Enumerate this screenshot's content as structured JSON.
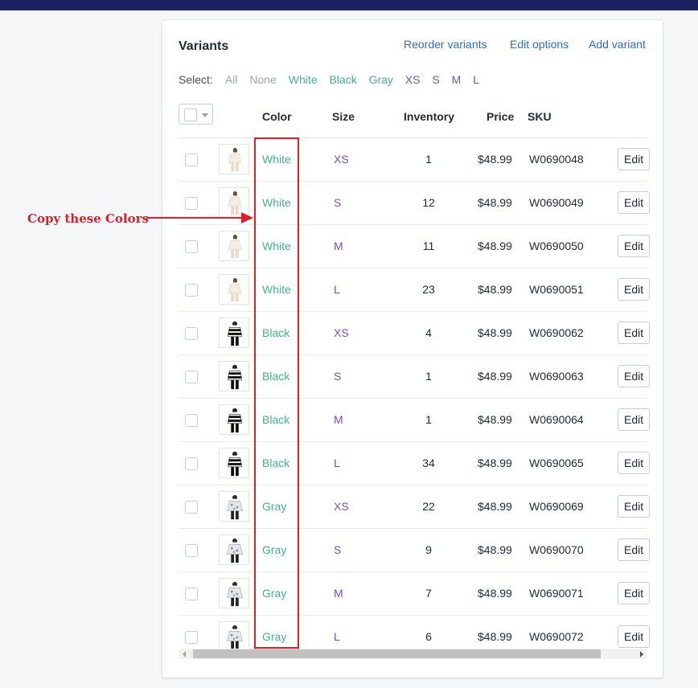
{
  "card": {
    "title": "Variants",
    "actions": {
      "reorder": "Reorder variants",
      "edit_options": "Edit options",
      "add_variant": "Add variant"
    }
  },
  "select": {
    "label": "Select:",
    "all": "All",
    "none": "None",
    "colors": [
      "White",
      "Black",
      "Gray"
    ],
    "sizes": [
      "XS",
      "S",
      "M",
      "L"
    ]
  },
  "columns": {
    "color": "Color",
    "size": "Size",
    "inventory": "Inventory",
    "price": "Price",
    "sku": "SKU"
  },
  "rows": [
    {
      "color": "White",
      "size": "XS",
      "inventory": "1",
      "price": "$48.99",
      "sku": "W0690048",
      "edit": "Edit"
    },
    {
      "color": "White",
      "size": "S",
      "inventory": "12",
      "price": "$48.99",
      "sku": "W0690049",
      "edit": "Edit"
    },
    {
      "color": "White",
      "size": "M",
      "inventory": "11",
      "price": "$48.99",
      "sku": "W0690050",
      "edit": "Edit"
    },
    {
      "color": "White",
      "size": "L",
      "inventory": "23",
      "price": "$48.99",
      "sku": "W0690051",
      "edit": "Edit"
    },
    {
      "color": "Black",
      "size": "XS",
      "inventory": "4",
      "price": "$48.99",
      "sku": "W0690062",
      "edit": "Edit"
    },
    {
      "color": "Black",
      "size": "S",
      "inventory": "1",
      "price": "$48.99",
      "sku": "W0690063",
      "edit": "Edit"
    },
    {
      "color": "Black",
      "size": "M",
      "inventory": "1",
      "price": "$48.99",
      "sku": "W0690064",
      "edit": "Edit"
    },
    {
      "color": "Black",
      "size": "L",
      "inventory": "34",
      "price": "$48.99",
      "sku": "W0690065",
      "edit": "Edit"
    },
    {
      "color": "Gray",
      "size": "XS",
      "inventory": "22",
      "price": "$48.99",
      "sku": "W0690069",
      "edit": "Edit"
    },
    {
      "color": "Gray",
      "size": "S",
      "inventory": "9",
      "price": "$48.99",
      "sku": "W0690070",
      "edit": "Edit"
    },
    {
      "color": "Gray",
      "size": "M",
      "inventory": "7",
      "price": "$48.99",
      "sku": "W0690071",
      "edit": "Edit"
    },
    {
      "color": "Gray",
      "size": "L",
      "inventory": "6",
      "price": "$48.99",
      "sku": "W0690072",
      "edit": "Edit"
    }
  ],
  "annotation": {
    "text": "Copy these Colors",
    "color": "#d6202a"
  },
  "theme": {
    "link": "#2c6ecb",
    "color_value": "#47b08a",
    "size_value": "#7b4fb5",
    "topbar": "#1c2260"
  }
}
